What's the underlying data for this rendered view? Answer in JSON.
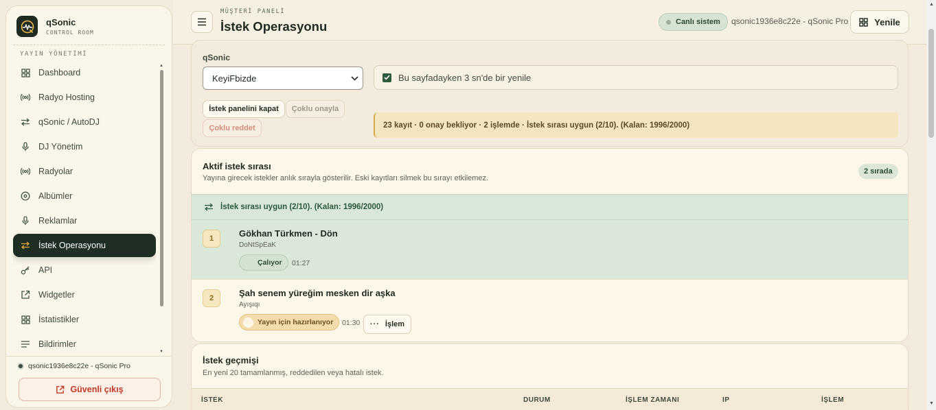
{
  "brand": {
    "title": "qSonic",
    "subtitle": "CONTROL ROOM"
  },
  "sidebar": {
    "section": "YAYIN YÖNETİMİ",
    "items": [
      {
        "label": "Dashboard",
        "icon": "grid-icon"
      },
      {
        "label": "Radyo Hosting",
        "icon": "broadcast-icon"
      },
      {
        "label": "qSonic / AutoDJ",
        "icon": "arrows-icon"
      },
      {
        "label": "DJ Yönetim",
        "icon": "mic-icon"
      },
      {
        "label": "Radyolar",
        "icon": "broadcast-icon"
      },
      {
        "label": "Albümler",
        "icon": "disc-icon"
      },
      {
        "label": "Reklamlar",
        "icon": "mic-icon"
      },
      {
        "label": "İstek Operasyonu",
        "icon": "arrows-icon",
        "active": true
      },
      {
        "label": "API",
        "icon": "key-icon"
      },
      {
        "label": "Widgetler",
        "icon": "external-icon"
      },
      {
        "label": "İstatistikler",
        "icon": "grid-icon"
      },
      {
        "label": "Bildirimler",
        "icon": "list-icon"
      }
    ],
    "user": "qsonic1936e8c22e - qSonic Pro",
    "logout": "Güvenli çıkış"
  },
  "header": {
    "eyebrow": "MÜŞTERİ PANELİ",
    "title": "İstek Operasyonu",
    "live_badge": "Canlı sistem",
    "user": "qsonic1936e8c22e - qSonic Pro",
    "refresh": "Yenile"
  },
  "controls": {
    "label": "qSonic",
    "select_value": "KeyiFbizde",
    "auto_refresh": "Bu sayfadayken 3 sn'de bir yenile",
    "close_panel": "İstek panelini kapat",
    "multi_approve": "Çoklu onayla",
    "multi_reject": "Çoklu reddet",
    "summary": "23 kayıt · 0 onay bekliyor · 2 işlemde · İstek sırası uygun (2/10). (Kalan: 1996/2000)"
  },
  "queue": {
    "title": "Aktif istek sırası",
    "desc": "Yayına girecek istekler anlık sırayla gösterilir. Eski kayıtları silmek bu sırayı etkilemez.",
    "count": "2 sırada",
    "status": "İstek sırası uygun (2/10). (Kalan: 1996/2000)",
    "rows": [
      {
        "num": "1",
        "title": "Gökhan Türkmen - Dön",
        "sub": "DoNtSpEaK",
        "state": "Çalıyor",
        "duration": "01:27"
      },
      {
        "num": "2",
        "title": "Şah senem yüreğim mesken dir aşka",
        "sub": "Ayışıqı",
        "state": "Yayın için hazırlanıyor",
        "duration": "01:30",
        "action": "İşlem"
      }
    ]
  },
  "history": {
    "title": "İstek geçmişi",
    "desc": "En yeni 20 tamamlanmış, reddedilen veya hatalı istek.",
    "columns": [
      "İSTEK",
      "DURUM",
      "İŞLEM ZAMANI",
      "IP",
      "İŞLEM"
    ]
  }
}
